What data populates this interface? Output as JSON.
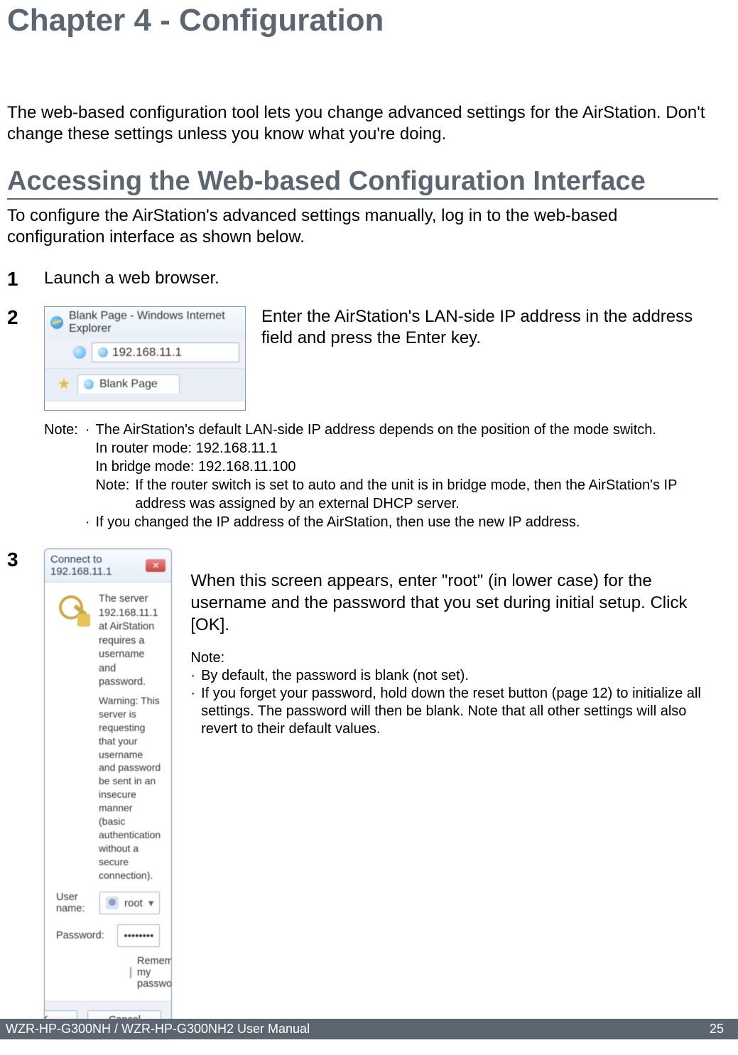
{
  "chapter_title": "Chapter 4 - Configuration",
  "intro": "The web-based configuration tool lets you change advanced settings for the AirStation. Don't change these settings unless you know what you're doing.",
  "section_title": "Accessing the Web-based Configuration Interface",
  "section_intro": "To configure the AirStation's advanced  settings manually, log in to the web-based configuration interface as shown below.",
  "steps": {
    "s1": {
      "num": "1",
      "text": "Launch a web browser."
    },
    "s2": {
      "num": "2",
      "text": "Enter the AirStation's LAN-side IP address in the address field and press the Enter key.",
      "browser": {
        "title": "Blank Page - Windows Internet Explorer",
        "address": "192.168.11.1",
        "tab_label": "Blank Page"
      },
      "note_label": "Note:",
      "bullet1_line1": "The AirStation's default LAN-side IP address depends on the position of the mode switch.",
      "bullet1_line2": "In router mode:  192.168.11.1",
      "bullet1_line3": "In bridge mode:  192.168.11.100",
      "subnote_label": "Note:",
      "subnote_text": "If the router switch is set to auto and the unit is in bridge mode, then the AirStation's IP address was assigned by an external DHCP server.",
      "bullet2": "If you changed the IP address of the AirStation, then use the new IP address."
    },
    "s3": {
      "num": "3",
      "dialog": {
        "title": "Connect to 192.168.11.1",
        "msg": "The server 192.168.11.1 at AirStation requires a username and password.",
        "warn": "Warning: This server is requesting that your username and password be sent in an insecure manner (basic authentication without a secure connection).",
        "user_label": "User name:",
        "user_value": "root",
        "pass_label": "Password:",
        "pass_value": "••••••••",
        "remember": "Remember my password",
        "ok": "OK",
        "cancel": "Cancel"
      },
      "text": "When this screen appears, enter \"root\" (in lower case) for the username and the password that you set during initial setup. Click [OK].",
      "note_label": "Note:",
      "bullet1": "By default, the password is blank (not set).",
      "bullet2": "If you forget your password, hold down the reset button (page 12) to initialize all settings. The password will then be blank.  Note that all other settings will also revert to their default values."
    }
  },
  "footer": {
    "left": "WZR-HP-G300NH / WZR-HP-G300NH2 User Manual",
    "right": "25"
  }
}
